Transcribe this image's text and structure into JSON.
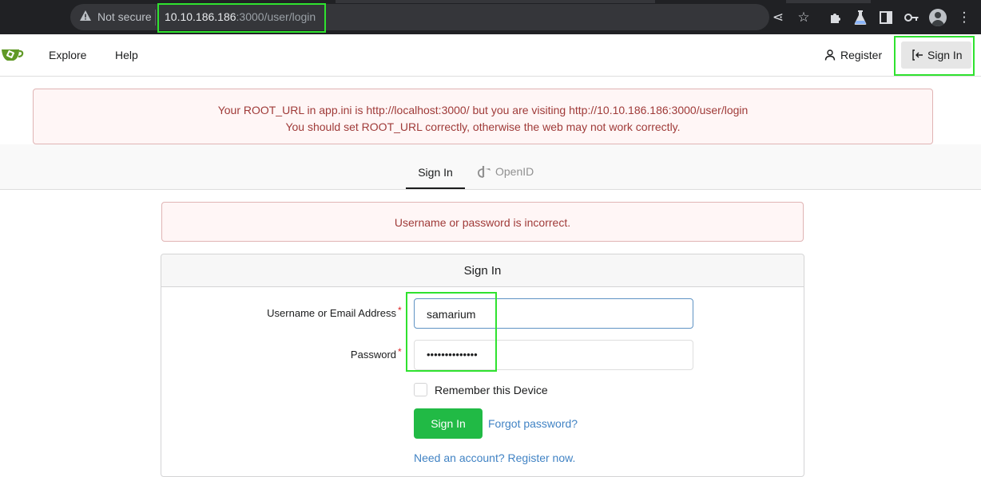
{
  "browser": {
    "security_label": "Not secure",
    "url_host": "10.10.186.186",
    "url_path": ":3000/user/login"
  },
  "header": {
    "nav": [
      "Explore",
      "Help"
    ],
    "register_label": "Register",
    "signin_label": "Sign In"
  },
  "root_warning": {
    "line1": "Your ROOT_URL in app.ini is http://localhost:3000/ but you are visiting http://10.10.186.186:3000/user/login",
    "line2": "You should set ROOT_URL correctly, otherwise the web may not work correctly."
  },
  "tabs": {
    "signin": "Sign In",
    "openid": "OpenID"
  },
  "error_message": "Username or password is incorrect.",
  "form": {
    "title": "Sign In",
    "username_label": "Username or Email Address",
    "username_value": "samarium",
    "password_label": "Password",
    "password_value": "••••••••••••••",
    "required_mark": "*",
    "remember_label": "Remember this Device",
    "submit_label": "Sign In",
    "forgot_label": "Forgot password?",
    "register_prompt": "Need an account? Register now."
  },
  "colors": {
    "highlight": "#2fe22f",
    "primary_button": "#21ba45",
    "link": "#4183c4",
    "error_text": "#9f3a38"
  }
}
